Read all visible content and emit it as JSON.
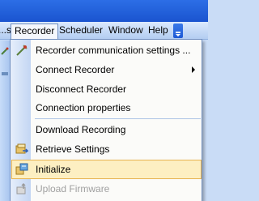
{
  "menubar": {
    "items": [
      {
        "label": "...s"
      },
      {
        "label": "Recorder"
      },
      {
        "label": "Scheduler"
      },
      {
        "label": "Window"
      },
      {
        "label": "Help"
      }
    ]
  },
  "dropdown": {
    "items": [
      {
        "label": "Recorder communication settings ...",
        "icon": "antenna-settings-icon"
      },
      {
        "label": "Connect Recorder",
        "submenu": true
      },
      {
        "label": "Disconnect Recorder"
      },
      {
        "label": "Connection properties"
      },
      {
        "label": "Download Recording"
      },
      {
        "label": "Retrieve Settings",
        "icon": "retrieve-settings-icon"
      },
      {
        "label": "Initialize",
        "icon": "initialize-icon",
        "highlighted": true
      },
      {
        "label": "Upload Firmware",
        "icon": "upload-firmware-icon",
        "disabled": true
      }
    ]
  },
  "colors": {
    "menubar_start": "#dbe9fd",
    "menubar_end": "#b3cdf1",
    "highlight_bg": "#fdefc2",
    "highlight_border": "#e7b352",
    "disabled_text": "#a0a0a0"
  }
}
